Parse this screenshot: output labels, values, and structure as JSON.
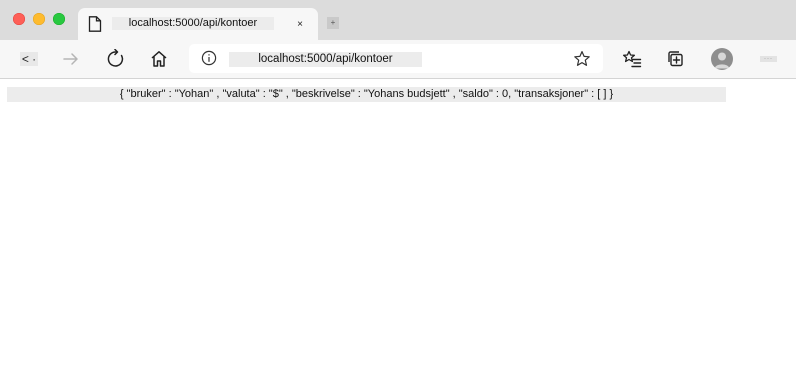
{
  "tab": {
    "title": "localhost:5000/api/kontoer",
    "close_label": "×",
    "new_tab_label": "+"
  },
  "toolbar": {
    "back_label": "< ·",
    "url": "localhost:5000/api/kontoer",
    "menu_label": "···"
  },
  "icons": {
    "back": "back-icon",
    "forward": "forward-icon",
    "reload": "reload-icon",
    "home": "home-icon",
    "info": "info-icon",
    "favorite": "star-icon",
    "favorites": "favorites-icon",
    "collections": "collections-icon",
    "profile": "avatar",
    "page": "page-icon"
  },
  "colors": {
    "close": "#fe5f57",
    "minimize": "#febb2e",
    "maximize": "#28c840"
  },
  "content": {
    "json_text": "{ \"bruker\" : \"Yohan\" , \"valuta\" : \"$\" , \"beskrivelse\" : \"Yohans budsjett\" , \"saldo\" : 0, \"transaksjoner\" : [ ] }"
  }
}
